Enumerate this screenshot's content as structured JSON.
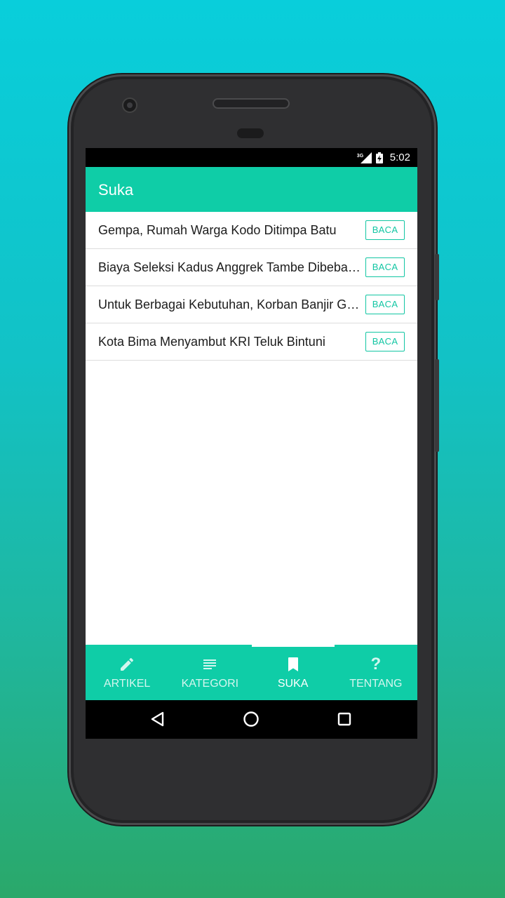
{
  "status_bar": {
    "network": "3G",
    "time": "5:02"
  },
  "app_bar": {
    "title": "Suka"
  },
  "likes": [
    {
      "title": "Gempa, Rumah Warga Kodo Ditimpa Batu",
      "action": "BACA"
    },
    {
      "title": "Biaya Seleksi Kadus Anggrek Tambe Dibebankan",
      "action": "BACA"
    },
    {
      "title": "Untuk Berbagai Kebutuhan, Korban Banjir Gunakan",
      "action": "BACA"
    },
    {
      "title": "Kota Bima Menyambut KRI Teluk Bintuni",
      "action": "BACA"
    }
  ],
  "bottom_nav": {
    "items": [
      {
        "label": "ARTIKEL",
        "icon": "pencil-icon"
      },
      {
        "label": "KATEGORI",
        "icon": "list-icon"
      },
      {
        "label": "SUKA",
        "icon": "bookmark-icon",
        "active": true
      },
      {
        "label": "TENTANG",
        "icon": "help-icon"
      }
    ]
  },
  "colors": {
    "accent": "#0fcda7",
    "button": "#12c6a3"
  }
}
